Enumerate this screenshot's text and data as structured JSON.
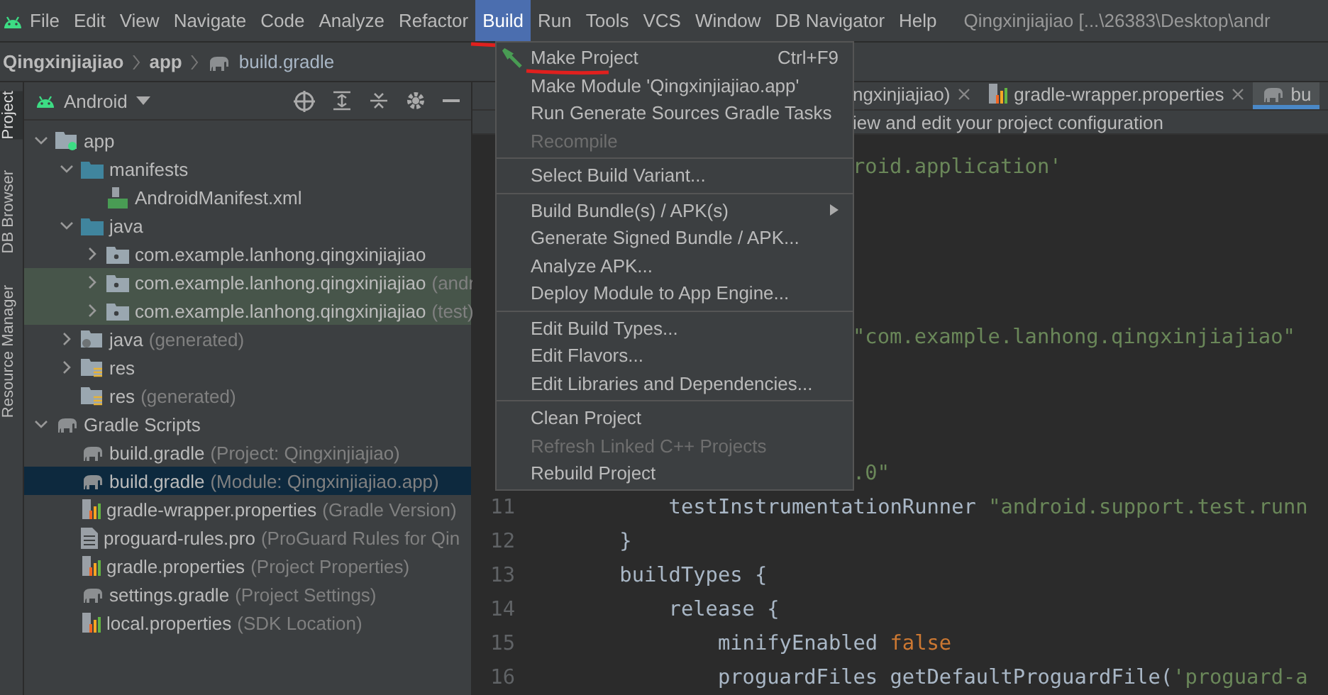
{
  "menu_bar": {
    "items": [
      {
        "label": "File",
        "selected": false,
        "underlined": false
      },
      {
        "label": "Edit",
        "selected": false,
        "underlined": false
      },
      {
        "label": "View",
        "selected": false,
        "underlined": false
      },
      {
        "label": "Navigate",
        "selected": false,
        "underlined": false
      },
      {
        "label": "Code",
        "selected": false,
        "underlined": false
      },
      {
        "label": "Analyze",
        "selected": false,
        "underlined": false
      },
      {
        "label": "Refactor",
        "selected": false,
        "underlined": false
      },
      {
        "label": "Build",
        "selected": true,
        "underlined": true
      },
      {
        "label": "Run",
        "selected": false,
        "underlined": false
      },
      {
        "label": "Tools",
        "selected": false,
        "underlined": false
      },
      {
        "label": "VCS",
        "selected": false,
        "underlined": false
      },
      {
        "label": "Window",
        "selected": false,
        "underlined": false
      },
      {
        "label": "DB Navigator",
        "selected": false,
        "underlined": false
      },
      {
        "label": "Help",
        "selected": false,
        "underlined": false
      }
    ],
    "window_title": "Qingxinjiajiao [...\\26383\\Desktop\\andr"
  },
  "breadcrumbs": [
    {
      "label": "Qingxinjiajiao",
      "kind": "project"
    },
    {
      "label": "app",
      "kind": "module"
    },
    {
      "label": "build.gradle",
      "kind": "gradle"
    }
  ],
  "tool_strip": [
    {
      "label": "Project",
      "selected": true
    },
    {
      "label": "DB Browser",
      "selected": false
    },
    {
      "label": "Resource Manager",
      "selected": false
    }
  ],
  "project_panel": {
    "view": "Android",
    "tree": [
      {
        "name": "app",
        "kind": "module",
        "expanded": true,
        "selected": false,
        "highlighted": false,
        "children": [
          {
            "name": "manifests",
            "kind": "folder",
            "expanded": true,
            "selected": false,
            "highlighted": false,
            "children": [
              {
                "name": "AndroidManifest.xml",
                "kind": "manifest",
                "selected": false,
                "highlighted": false
              }
            ]
          },
          {
            "name": "java",
            "kind": "folder",
            "expanded": true,
            "selected": false,
            "highlighted": false,
            "children": [
              {
                "name": "com.example.lanhong.qingxinjiajiao",
                "kind": "package",
                "expanded": false,
                "selected": false,
                "highlighted": false
              },
              {
                "name": "com.example.lanhong.qingxinjiajiao",
                "hint": "(andr",
                "kind": "package",
                "expanded": false,
                "selected": false,
                "highlighted": true
              },
              {
                "name": "com.example.lanhong.qingxinjiajiao",
                "hint": "(test)",
                "kind": "package",
                "expanded": false,
                "selected": false,
                "highlighted": true
              }
            ]
          },
          {
            "name": "java",
            "hint": "(generated)",
            "kind": "generated",
            "expanded": false,
            "selected": false,
            "highlighted": false
          },
          {
            "name": "res",
            "kind": "resources",
            "expanded": false,
            "selected": false,
            "highlighted": false
          },
          {
            "name": "res",
            "hint": "(generated)",
            "kind": "resources",
            "selected": false,
            "highlighted": false
          }
        ]
      },
      {
        "name": "Gradle Scripts",
        "kind": "gradle",
        "expanded": true,
        "selected": false,
        "highlighted": false,
        "children": [
          {
            "name": "build.gradle",
            "hint": "(Project: Qingxinjiajiao)",
            "kind": "gradle",
            "selected": false,
            "highlighted": false
          },
          {
            "name": "build.gradle",
            "hint": "(Module: Qingxinjiajiao.app)",
            "kind": "gradle",
            "selected": true,
            "highlighted": false
          },
          {
            "name": "gradle-wrapper.properties",
            "hint": "(Gradle Version)",
            "kind": "properties",
            "selected": false,
            "highlighted": false
          },
          {
            "name": "proguard-rules.pro",
            "hint": "(ProGuard Rules for Qin",
            "kind": "text",
            "selected": false,
            "highlighted": false
          },
          {
            "name": "gradle.properties",
            "hint": "(Project Properties)",
            "kind": "properties",
            "selected": false,
            "highlighted": false
          },
          {
            "name": "settings.gradle",
            "hint": "(Project Settings)",
            "kind": "gradle",
            "selected": false,
            "highlighted": false
          },
          {
            "name": "local.properties",
            "hint": "(SDK Location)",
            "kind": "properties",
            "selected": false,
            "highlighted": false
          }
        ]
      }
    ]
  },
  "editor": {
    "tabs": [
      {
        "label": "ngxinjiajiao)",
        "kind": "plain",
        "selected": false,
        "closable": true
      },
      {
        "label": "gradle-wrapper.properties",
        "kind": "properties",
        "selected": false,
        "closable": true
      },
      {
        "label": "bu",
        "kind": "gradle",
        "selected": true,
        "closable": false
      }
    ],
    "info_bar": "iew and edit your project configuration",
    "lines": [
      {
        "kind": "fragment",
        "segments": [
          {
            "text": "roid.application'",
            "kind": "string"
          }
        ]
      },
      {
        "kind": "blank"
      },
      {
        "kind": "blank"
      },
      {
        "kind": "blank"
      },
      {
        "kind": "blank"
      },
      {
        "kind": "fragment",
        "segments": [
          {
            "text": "\"com.example.lanhong.qingxinjiajiao\"",
            "kind": "string"
          }
        ]
      },
      {
        "kind": "blank"
      },
      {
        "kind": "blank"
      },
      {
        "kind": "blank"
      },
      {
        "kind": "fragment",
        "segments": [
          {
            "text": ".0\"",
            "kind": "string"
          }
        ]
      },
      {
        "kind": "line",
        "number": "11",
        "segments": [
          {
            "text": "        testInstrumentationRunner ",
            "kind": "plain"
          },
          {
            "text": "\"android.support.test.runn",
            "kind": "string"
          }
        ]
      },
      {
        "kind": "line",
        "number": "12",
        "segments": [
          {
            "text": "    }",
            "kind": "plain"
          }
        ]
      },
      {
        "kind": "line",
        "number": "13",
        "segments": [
          {
            "text": "    buildTypes {",
            "kind": "plain"
          }
        ]
      },
      {
        "kind": "line",
        "number": "14",
        "segments": [
          {
            "text": "        release {",
            "kind": "plain"
          }
        ]
      },
      {
        "kind": "line",
        "number": "15",
        "segments": [
          {
            "text": "            minifyEnabled ",
            "kind": "plain"
          },
          {
            "text": "false",
            "kind": "keyword"
          }
        ]
      },
      {
        "kind": "line",
        "number": "16",
        "segments": [
          {
            "text": "            proguardFiles getDefaultProguardFile(",
            "kind": "plain"
          },
          {
            "text": "'proguard-a",
            "kind": "string"
          }
        ]
      }
    ]
  },
  "build_menu": {
    "items": [
      {
        "kind": "action",
        "label": "Make Project",
        "shortcut": "Ctrl+F9",
        "disabled": false,
        "submenu": false,
        "underlined": true
      },
      {
        "kind": "item",
        "label": "Make Module 'Qingxinjiajiao.app'",
        "disabled": false,
        "submenu": false,
        "underlined": false
      },
      {
        "kind": "item",
        "label": "Run Generate Sources Gradle Tasks",
        "disabled": false,
        "submenu": false,
        "underlined": false
      },
      {
        "kind": "item",
        "label": "Recompile",
        "disabled": true,
        "submenu": false,
        "underlined": false
      },
      {
        "kind": "separator"
      },
      {
        "kind": "item",
        "label": "Select Build Variant...",
        "disabled": false,
        "submenu": false,
        "underlined": false
      },
      {
        "kind": "separator"
      },
      {
        "kind": "item",
        "label": "Build Bundle(s) / APK(s)",
        "disabled": false,
        "submenu": true,
        "underlined": false
      },
      {
        "kind": "item",
        "label": "Generate Signed Bundle / APK...",
        "disabled": false,
        "submenu": false,
        "underlined": false
      },
      {
        "kind": "item",
        "label": "Analyze APK...",
        "disabled": false,
        "submenu": false,
        "underlined": false
      },
      {
        "kind": "item",
        "label": "Deploy Module to App Engine...",
        "disabled": false,
        "submenu": false,
        "underlined": false
      },
      {
        "kind": "separator"
      },
      {
        "kind": "item",
        "label": "Edit Build Types...",
        "disabled": false,
        "submenu": false,
        "underlined": false
      },
      {
        "kind": "item",
        "label": "Edit Flavors...",
        "disabled": false,
        "submenu": false,
        "underlined": false
      },
      {
        "kind": "item",
        "label": "Edit Libraries and Dependencies...",
        "disabled": false,
        "submenu": false,
        "underlined": false
      },
      {
        "kind": "separator"
      },
      {
        "kind": "item",
        "label": "Clean Project",
        "disabled": false,
        "submenu": false,
        "underlined": false
      },
      {
        "kind": "item",
        "label": "Refresh Linked C++ Projects",
        "disabled": true,
        "submenu": false,
        "underlined": false
      },
      {
        "kind": "item",
        "label": "Rebuild Project",
        "disabled": false,
        "submenu": false,
        "underlined": false
      }
    ]
  }
}
